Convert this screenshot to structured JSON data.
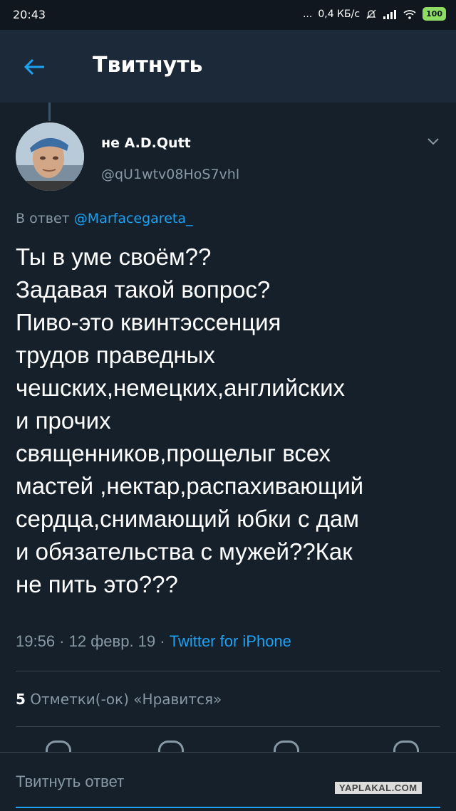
{
  "status_bar": {
    "time": "20:43",
    "dots": "...",
    "network_speed": "0,4 КБ/с",
    "battery": "100",
    "icons": [
      "muted-bell-icon",
      "signal-icon",
      "wifi-icon",
      "battery-icon"
    ]
  },
  "app_bar": {
    "title": "Твитнуть",
    "back_icon": "arrow-left-icon"
  },
  "tweet": {
    "author_name": "не A.D.Qutt",
    "handle": "@qU1wtv08HoS7vhl",
    "reply_prefix": "В ответ",
    "reply_mention": "@Marfacegareta_",
    "text": "Ты в уме своём??\nЗадавая такой вопрос?\nПиво-это квинтэссенция\nтрудов праведных\nчешских,немецких,английских\nи прочих\nсвященников,прощелыг всех\nмастей ,нектар,распахивающий\nсердца,снимающий юбки с дам\nи обязательства с мужей??Как\nне пить это???",
    "timestamp": "19:56 · 12 февр. 19 ·",
    "source": "Twitter for iPhone",
    "likes_count": "5",
    "likes_label": "Отметки(-ок) «Нравится»"
  },
  "compose": {
    "placeholder": "Твитнуть ответ"
  },
  "watermark": "YAPLAKAL.COM",
  "colors": {
    "background": "#15202b",
    "app_bar": "#1c2938",
    "accent": "#1da1f2",
    "secondary_text": "#8899a6"
  }
}
